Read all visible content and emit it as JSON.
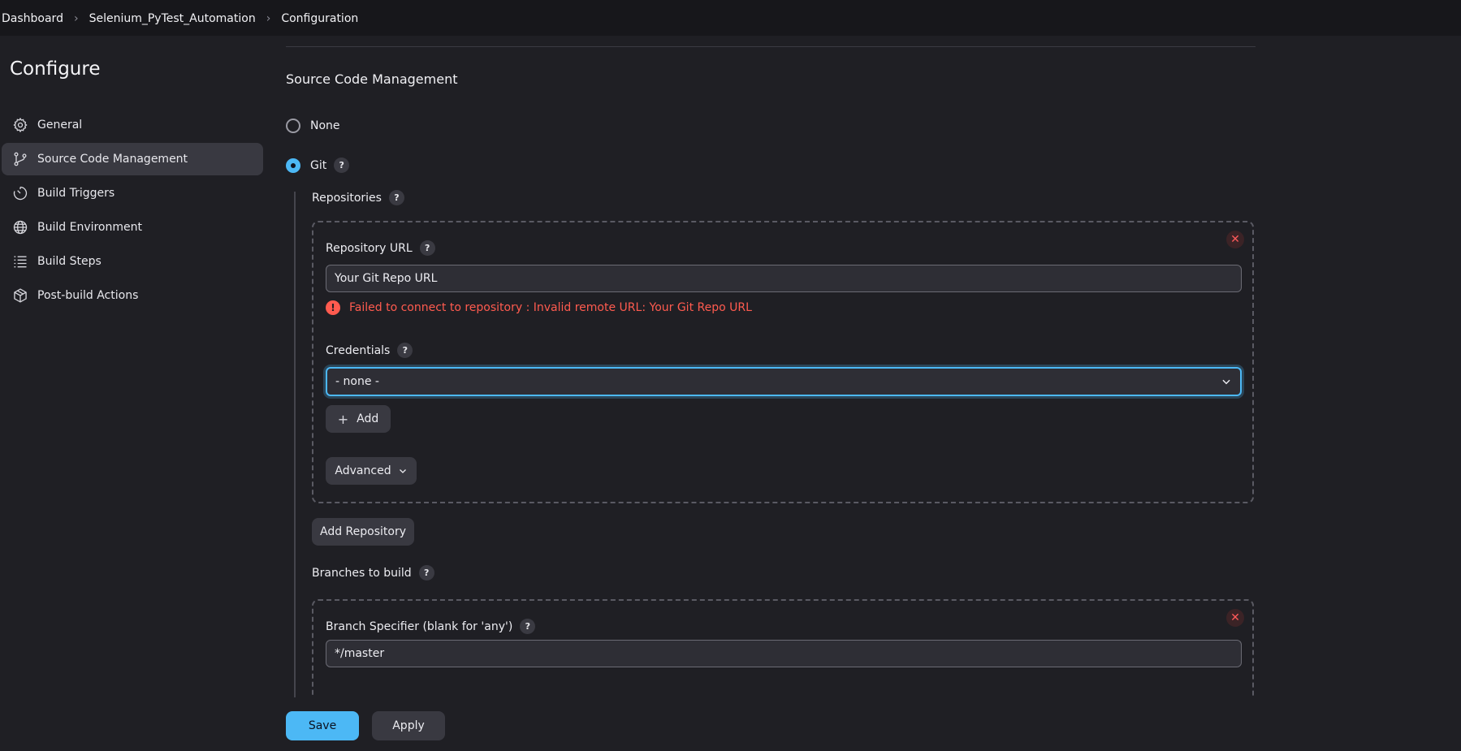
{
  "breadcrumb": [
    "Dashboard",
    "Selenium_PyTest_Automation",
    "Configuration"
  ],
  "sidebar": {
    "title": "Configure",
    "items": [
      {
        "label": "General",
        "icon": "gear-icon"
      },
      {
        "label": "Source Code Management",
        "icon": "git-branch-icon",
        "active": true
      },
      {
        "label": "Build Triggers",
        "icon": "timer-icon"
      },
      {
        "label": "Build Environment",
        "icon": "globe-icon"
      },
      {
        "label": "Build Steps",
        "icon": "list-icon"
      },
      {
        "label": "Post-build Actions",
        "icon": "package-icon"
      }
    ]
  },
  "main": {
    "section_title": "Source Code Management",
    "scm_options": [
      {
        "label": "None",
        "selected": false
      },
      {
        "label": "Git",
        "selected": true
      }
    ],
    "repositories_label": "Repositories",
    "repository_url_label": "Repository URL",
    "repository_url_value": "Your Git Repo URL",
    "error_text": "Failed to connect to repository : Invalid remote URL: Your Git Repo URL",
    "credentials_label": "Credentials",
    "credentials_value": "- none -",
    "add_label": "Add",
    "advanced_label": "Advanced",
    "add_repository_label": "Add Repository",
    "branches_label": "Branches to build",
    "branch_specifier_label": "Branch Specifier (blank for 'any')",
    "branch_specifier_value": "*/master",
    "help_glyph": "?",
    "close_glyph": "✕"
  },
  "footer": {
    "save_label": "Save",
    "apply_label": "Apply"
  },
  "colors": {
    "accent": "#4cb8f5",
    "error": "#ff5b4f",
    "background": "#1f1f24"
  }
}
